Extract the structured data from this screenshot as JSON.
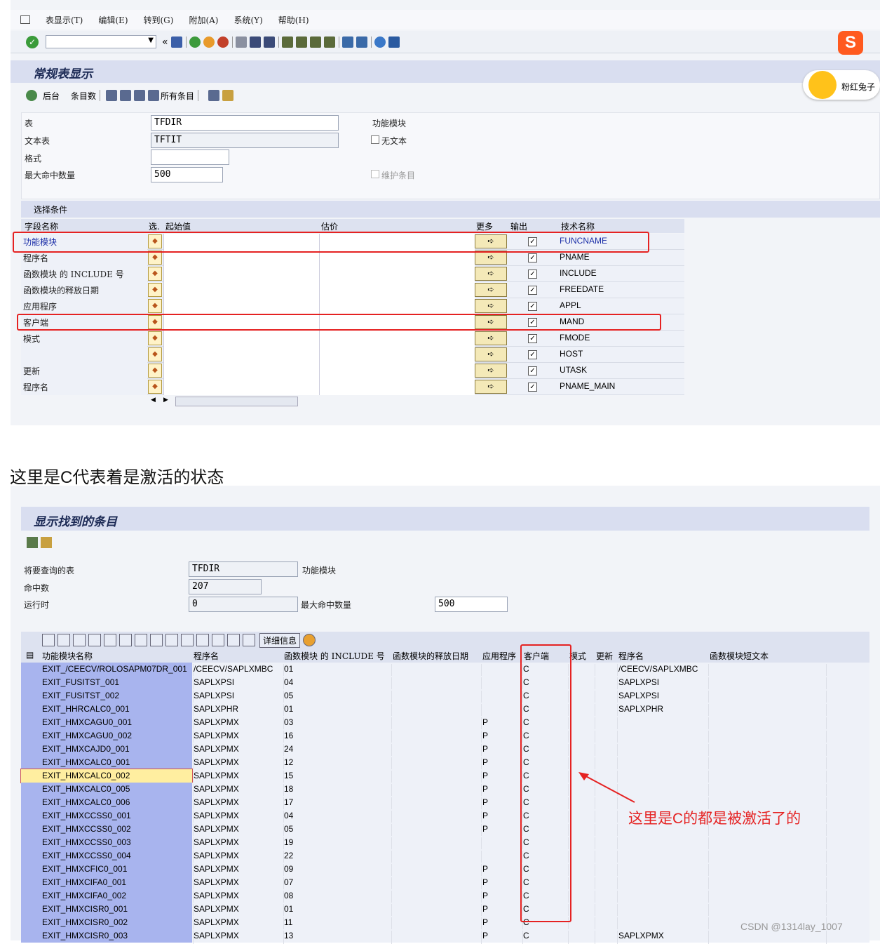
{
  "menu": {
    "items": [
      "表显示(T)",
      "编辑(E)",
      "转到(G)",
      "附加(A)",
      "系统(Y)",
      "帮助(H)"
    ]
  },
  "toolbar": {
    "ok_icon": "check-icon",
    "command_field_value": "",
    "back_glyph": "«"
  },
  "screen1": {
    "title": "常规表显示",
    "app_toolbar": {
      "backend_label": "后台",
      "count_label": "条目数",
      "all_entries_label": "所有条目"
    },
    "form": {
      "table_label": "表",
      "table_value": "TFDIR",
      "text_table_label": "文本表",
      "text_table_value": "TFTIT",
      "format_label": "格式",
      "format_value": "",
      "max_hits_label": "最大命中数量",
      "max_hits_value": "500",
      "func_module_label": "功能模块",
      "no_text_label": "无文本",
      "maintain_entries_label": "维护条目"
    },
    "selection_header": "选择条件",
    "grid_headers": {
      "field": "字段名称",
      "sel": "选.",
      "low": "起始值",
      "high": "估价",
      "more": "更多",
      "output": "输出",
      "tech": "技术名称"
    },
    "grid_rows": [
      {
        "field": "功能模块",
        "tech": "FUNCNAME",
        "output": "✓"
      },
      {
        "field": "程序名",
        "tech": "PNAME",
        "output": "✓"
      },
      {
        "field": "函数模块 的 INCLUDE 号",
        "tech": "INCLUDE",
        "output": "✓"
      },
      {
        "field": "函数模块的释放日期",
        "tech": "FREEDATE",
        "output": "✓"
      },
      {
        "field": "应用程序",
        "tech": "APPL",
        "output": "✓"
      },
      {
        "field": "客户端",
        "tech": "MAND",
        "output": "✓"
      },
      {
        "field": "模式",
        "tech": "FMODE",
        "output": "✓"
      },
      {
        "field": "",
        "tech": "HOST",
        "output": "✓"
      },
      {
        "field": "更新",
        "tech": "UTASK",
        "output": "✓"
      },
      {
        "field": "程序名",
        "tech": "PNAME_MAIN",
        "output": "✓"
      }
    ]
  },
  "side_widget": {
    "label": "粉红兔子"
  },
  "caption": "这里是C代表着是激活的状态",
  "screen2": {
    "title": "显示找到的条目",
    "form": {
      "query_table_label": "将要查询的表",
      "query_table_value": "TFDIR",
      "query_table_desc": "功能模块",
      "hits_label": "命中数",
      "hits_value": "207",
      "runtime_label": "运行时",
      "runtime_value": "0",
      "max_hits_label": "最大命中数量",
      "max_hits_value": "500"
    },
    "toolbar": {
      "details_label": "详细信息"
    },
    "list_headers": {
      "name": "功能模块名称",
      "prog": "程序名",
      "include": "函数模块 的 INCLUDE 号",
      "date": "函数模块的释放日期",
      "appl": "应用程序",
      "client": "客户端",
      "mode": "模式",
      "update": "更新",
      "prog_main": "程序名",
      "short_text": "函数模块短文本"
    },
    "list_rows": [
      {
        "name": "EXIT_/CEECV/ROLOSAPM07DR_001",
        "prog": "/CEECV/SAPLXMBC",
        "inc": "01",
        "appl": "",
        "client": "C",
        "main": "/CEECV/SAPLXMBC"
      },
      {
        "name": "EXIT_FUSITST_001",
        "prog": "SAPLXPSI",
        "inc": "04",
        "appl": "",
        "client": "C",
        "main": "SAPLXPSI"
      },
      {
        "name": "EXIT_FUSITST_002",
        "prog": "SAPLXPSI",
        "inc": "05",
        "appl": "",
        "client": "C",
        "main": "SAPLXPSI"
      },
      {
        "name": "EXIT_HHRCALC0_001",
        "prog": "SAPLXPHR",
        "inc": "01",
        "appl": "",
        "client": "C",
        "main": "SAPLXPHR"
      },
      {
        "name": "EXIT_HMXCAGU0_001",
        "prog": "SAPLXPMX",
        "inc": "03",
        "appl": "P",
        "client": "C",
        "main": ""
      },
      {
        "name": "EXIT_HMXCAGU0_002",
        "prog": "SAPLXPMX",
        "inc": "16",
        "appl": "P",
        "client": "C",
        "main": ""
      },
      {
        "name": "EXIT_HMXCAJD0_001",
        "prog": "SAPLXPMX",
        "inc": "24",
        "appl": "P",
        "client": "C",
        "main": ""
      },
      {
        "name": "EXIT_HMXCALC0_001",
        "prog": "SAPLXPMX",
        "inc": "12",
        "appl": "P",
        "client": "C",
        "main": ""
      },
      {
        "name": "EXIT_HMXCALC0_002",
        "prog": "SAPLXPMX",
        "inc": "15",
        "appl": "P",
        "client": "C",
        "main": ""
      },
      {
        "name": "EXIT_HMXCALC0_005",
        "prog": "SAPLXPMX",
        "inc": "18",
        "appl": "P",
        "client": "C",
        "main": ""
      },
      {
        "name": "EXIT_HMXCALC0_006",
        "prog": "SAPLXPMX",
        "inc": "17",
        "appl": "P",
        "client": "C",
        "main": ""
      },
      {
        "name": "EXIT_HMXCCSS0_001",
        "prog": "SAPLXPMX",
        "inc": "04",
        "appl": "P",
        "client": "C",
        "main": ""
      },
      {
        "name": "EXIT_HMXCCSS0_002",
        "prog": "SAPLXPMX",
        "inc": "05",
        "appl": "P",
        "client": "C",
        "main": ""
      },
      {
        "name": "EXIT_HMXCCSS0_003",
        "prog": "SAPLXPMX",
        "inc": "19",
        "appl": "",
        "client": "C",
        "main": ""
      },
      {
        "name": "EXIT_HMXCCSS0_004",
        "prog": "SAPLXPMX",
        "inc": "22",
        "appl": "",
        "client": "C",
        "main": ""
      },
      {
        "name": "EXIT_HMXCFIC0_001",
        "prog": "SAPLXPMX",
        "inc": "09",
        "appl": "P",
        "client": "C",
        "main": ""
      },
      {
        "name": "EXIT_HMXCIFA0_001",
        "prog": "SAPLXPMX",
        "inc": "07",
        "appl": "P",
        "client": "C",
        "main": ""
      },
      {
        "name": "EXIT_HMXCIFA0_002",
        "prog": "SAPLXPMX",
        "inc": "08",
        "appl": "P",
        "client": "C",
        "main": ""
      },
      {
        "name": "EXIT_HMXCISR0_001",
        "prog": "SAPLXPMX",
        "inc": "01",
        "appl": "P",
        "client": "C",
        "main": ""
      },
      {
        "name": "EXIT_HMXCISR0_002",
        "prog": "SAPLXPMX",
        "inc": "11",
        "appl": "P",
        "client": "C",
        "main": ""
      },
      {
        "name": "EXIT_HMXCISR0_003",
        "prog": "SAPLXPMX",
        "inc": "13",
        "appl": "P",
        "client": "C",
        "main": "SAPLXPMX"
      }
    ]
  },
  "annotation": "这里是C的都是被激活了的",
  "watermark_credit": "CSDN @1314lay_1007",
  "colors": {
    "highlight_red": "#e52222",
    "key_column_blue": "#a8b4ee",
    "title_bar": "#d9def0"
  }
}
